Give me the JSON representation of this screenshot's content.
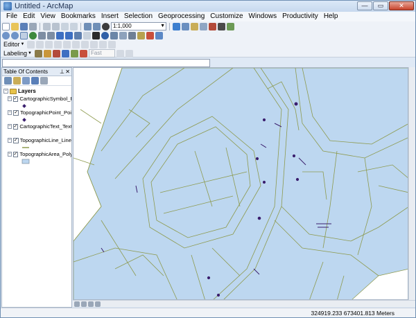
{
  "window": {
    "title": "Untitled - ArcMap"
  },
  "menu": [
    "File",
    "Edit",
    "View",
    "Bookmarks",
    "Insert",
    "Selection",
    "Geoprocessing",
    "Customize",
    "Windows",
    "Productivity",
    "Help"
  ],
  "toolbar": {
    "scale_value": "1:1,000",
    "editor_label": "Editor",
    "labeling_label": "Labeling",
    "label_quality": "Fast"
  },
  "toc": {
    "title": "Table Of Contents",
    "group": "Layers",
    "layers": [
      {
        "name": "CartographicSymbol_F",
        "symbol": "point"
      },
      {
        "name": "TopographicPoint_Poi",
        "symbol": "point"
      },
      {
        "name": "CartographicText_Text",
        "symbol": "none"
      },
      {
        "name": "TopographicLine_Line",
        "symbol": "line"
      },
      {
        "name": "TopographicArea_Poly",
        "symbol": "polygon"
      }
    ]
  },
  "status": {
    "coordinates": "324919.233  673401.813 Meters"
  },
  "colors": {
    "area_fill": "#bdd7f0",
    "line": "#8d9a4e",
    "symbol": "#3b1f6e"
  }
}
